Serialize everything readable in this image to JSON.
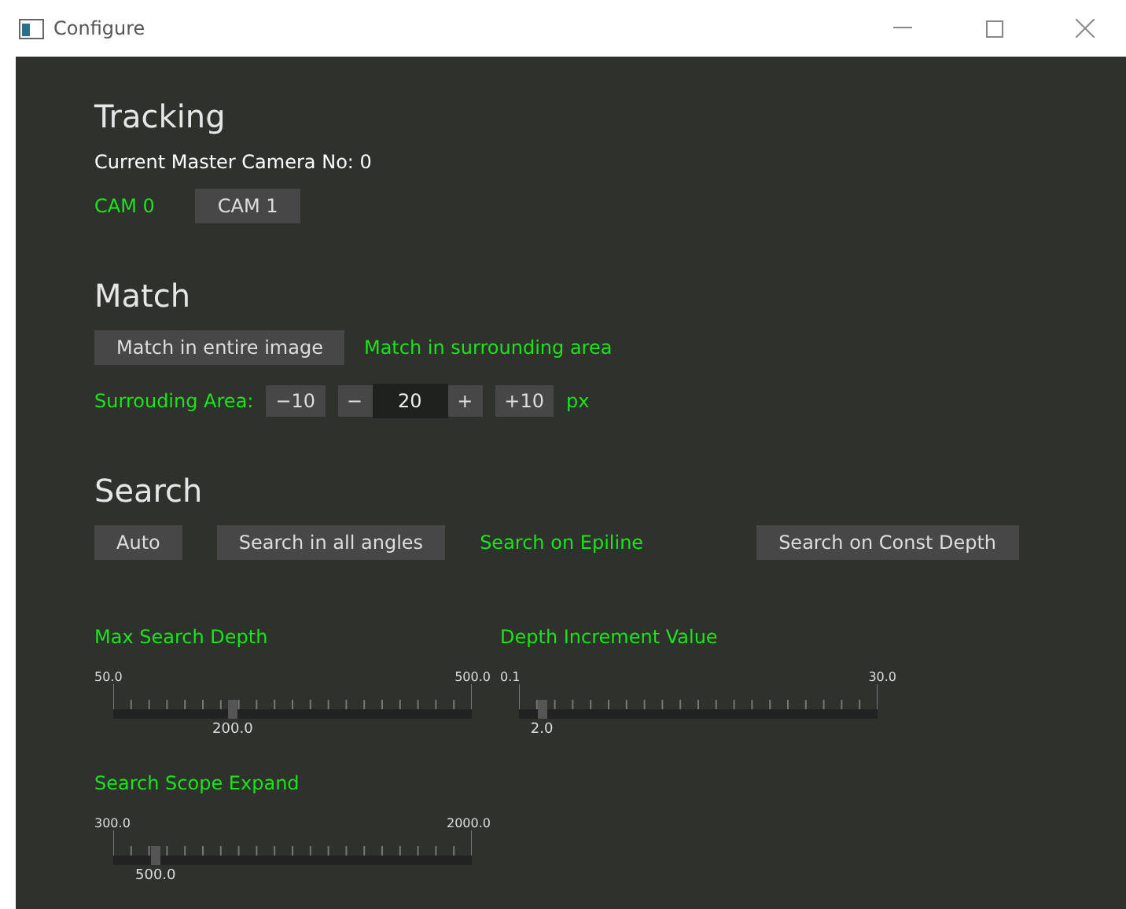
{
  "window": {
    "title": "Configure"
  },
  "tracking": {
    "title": "Tracking",
    "caption": "Current Master Camera No: 0",
    "options": [
      {
        "label": "CAM 0",
        "selected": true
      },
      {
        "label": "CAM 1",
        "selected": false
      }
    ]
  },
  "match": {
    "title": "Match",
    "options": [
      {
        "label": "Match in entire image",
        "selected": false
      },
      {
        "label": "Match in surrounding area",
        "selected": true
      }
    ],
    "area": {
      "label": "Surrouding Area:",
      "minus10": "−10",
      "minus": "−",
      "value": "20",
      "plus": "+",
      "plus10": "+10",
      "unit": "px"
    }
  },
  "search": {
    "title": "Search",
    "options": [
      {
        "label": "Auto",
        "selected": false
      },
      {
        "label": "Search in all angles",
        "selected": false
      },
      {
        "label": "Search on Epiline",
        "selected": true
      },
      {
        "label": "Search on Const Depth",
        "selected": false
      }
    ],
    "sliders": [
      {
        "label": "Max Search Depth",
        "min": "50.0",
        "max": "500.0",
        "value": "200.0",
        "level": 0.333
      },
      {
        "label": "Depth Increment Value",
        "min": "0.1",
        "max": "30.0",
        "value": "2.0",
        "level": 0.064
      },
      {
        "label": "Search Scope Expand",
        "min": "300.0",
        "max": "2000.0",
        "value": "500.0",
        "level": 0.118
      }
    ]
  }
}
